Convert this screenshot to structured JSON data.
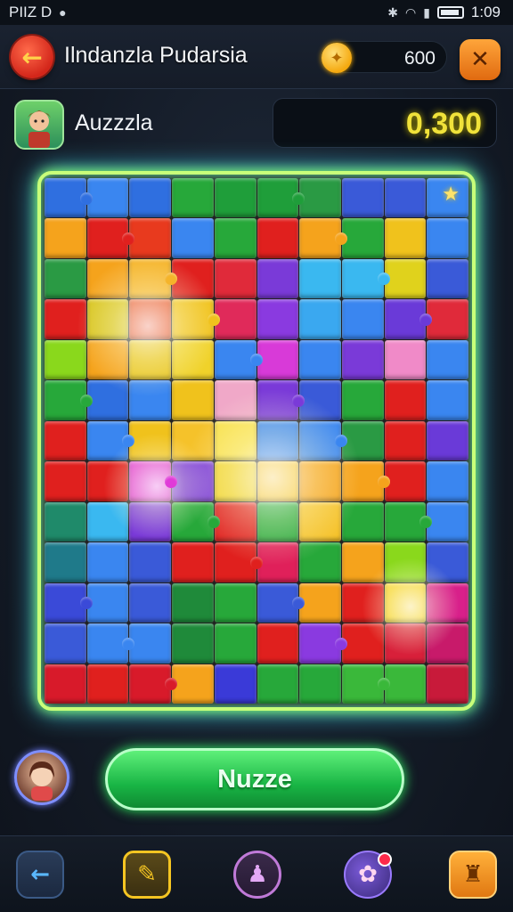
{
  "status_bar": {
    "left_text": "PIIZ D",
    "time": "1:09"
  },
  "header": {
    "title": "Ilndanzla Pudarsia",
    "coins": "600"
  },
  "player": {
    "name": "Auzzzla",
    "score": "0,300"
  },
  "actions": {
    "main_button_label": "Nuzze"
  },
  "icons": {
    "back": "back-arrow-icon",
    "coin": "coin-icon",
    "tools": "tools-icon",
    "star": "star-icon",
    "nav": [
      "back-arrow-icon",
      "edit-icon",
      "person-icon",
      "palette-icon",
      "joystick-icon"
    ]
  },
  "colors": {
    "board_glow": "#8cff5a",
    "score": "#f0e23a",
    "main_button": "#19b545"
  },
  "board": {
    "cols": 10,
    "rows": 12,
    "tiles": [
      [
        "#2f6fe0",
        "#3a86f0",
        "#2f6fe0",
        "#27a83a",
        "#1f9e3a",
        "#1f9e3a",
        "#2a9a44",
        "#3a5ad8",
        "#3a5ad8",
        "#3a86f0"
      ],
      [
        "#f5a31c",
        "#e0201e",
        "#e83a1e",
        "#3a86f0",
        "#27a83a",
        "#e0201e",
        "#f5a31c",
        "#27a83a",
        "#f0c21c",
        "#3a86f0"
      ],
      [
        "#2a9a44",
        "#f5a31c",
        "#f5b42a",
        "#e0201e",
        "#e02a3a",
        "#7a3ad8",
        "#3ab8f0",
        "#3ab8f0",
        "#e0d21c",
        "#3a5ad8"
      ],
      [
        "#e0201e",
        "#d8c41c",
        "#e8502a",
        "#f0c21c",
        "#e02a5a",
        "#8a3ae0",
        "#3aa8f0",
        "#3a86f0",
        "#6a3ad8",
        "#e02a3a"
      ],
      [
        "#8ad81c",
        "#f5a31c",
        "#e8c41c",
        "#f0d22a",
        "#3a86f0",
        "#d83ad8",
        "#3a86f0",
        "#7a3ad8",
        "#f08ac8",
        "#3a86f0"
      ],
      [
        "#27a83a",
        "#2f6fe0",
        "#3a86f0",
        "#f0c21c",
        "#f0a8c8",
        "#7a3ad8",
        "#3a5ad8",
        "#27a83a",
        "#e0201e",
        "#3a86f0"
      ],
      [
        "#e0201e",
        "#3a86f0",
        "#f0c21c",
        "#f5c22a",
        "#f8e04a",
        "#3a86f0",
        "#3a86f0",
        "#2a9a44",
        "#e0201e",
        "#6a3ad8"
      ],
      [
        "#e0201e",
        "#e0201e",
        "#e03ad8",
        "#7a3ad8",
        "#f0d22a",
        "#f5c22a",
        "#f5a31c",
        "#f5a31c",
        "#e0201e",
        "#3a86f0"
      ],
      [
        "#1f8a6a",
        "#3ab8f0",
        "#7a3ad8",
        "#27a83a",
        "#e0201e",
        "#27a83a",
        "#f5c22a",
        "#27a83a",
        "#27a83a",
        "#3a86f0"
      ],
      [
        "#1f7a8a",
        "#3a86f0",
        "#3a5ad8",
        "#e0201e",
        "#e0201e",
        "#e0205a",
        "#27a83a",
        "#f5a31c",
        "#8ad81c",
        "#3a5ad8"
      ],
      [
        "#3a4ad8",
        "#3a86f0",
        "#3a5ad8",
        "#1f8a3a",
        "#27a83a",
        "#3a5ad8",
        "#f5a31c",
        "#e0201e",
        "#f5d22a",
        "#d8208a"
      ],
      [
        "#3a5ad8",
        "#3a86f0",
        "#3a86f0",
        "#1f8a3a",
        "#27a83a",
        "#e0201e",
        "#8a3ae0",
        "#e0201e",
        "#d8203a",
        "#c81a6a"
      ],
      [
        "#d81a2a",
        "#e0201e",
        "#d81a2a",
        "#f5a31c",
        "#3a3ad8",
        "#27a83a",
        "#27a83a",
        "#3ab83a",
        "#3ab83a",
        "#c81a3a"
      ]
    ]
  }
}
